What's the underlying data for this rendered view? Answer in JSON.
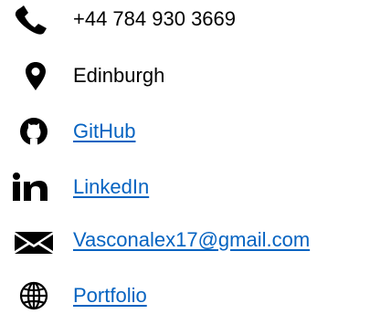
{
  "contacts": [
    {
      "type": "phone",
      "icon": "phone-icon",
      "text": "+44 784 930 3669",
      "link": false
    },
    {
      "type": "location",
      "icon": "location-pin-icon",
      "text": "Edinburgh",
      "link": false
    },
    {
      "type": "github",
      "icon": "github-icon",
      "text": "GitHub",
      "link": true
    },
    {
      "type": "linkedin",
      "icon": "linkedin-icon",
      "text": "LinkedIn",
      "link": true
    },
    {
      "type": "email",
      "icon": "envelope-icon",
      "text": "Vasconalex17@gmail.com",
      "link": true
    },
    {
      "type": "portfolio",
      "icon": "globe-icon",
      "text": "Portfolio",
      "link": true
    }
  ],
  "colors": {
    "text": "#000000",
    "link": "#0563c1",
    "icon": "#000000"
  }
}
